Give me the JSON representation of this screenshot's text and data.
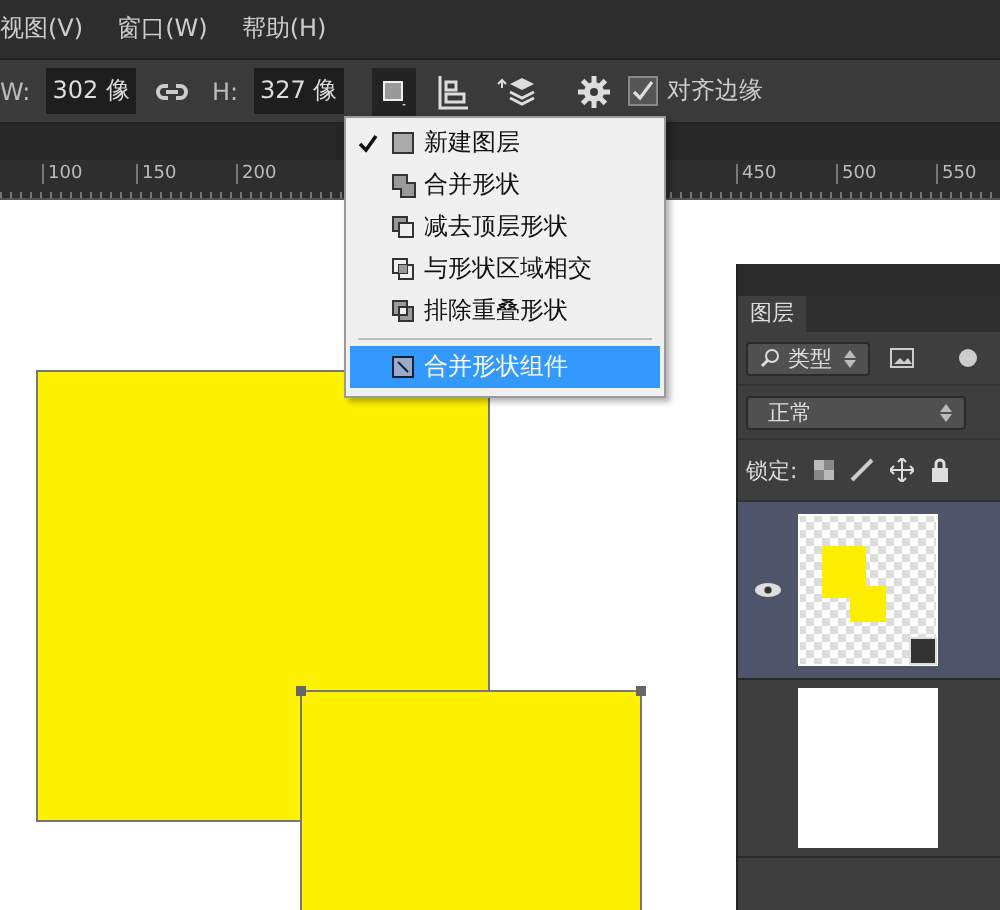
{
  "menubar": [
    "视图(V)",
    "窗口(W)",
    "帮助(H)"
  ],
  "options_bar": {
    "width_label": "W:",
    "width_value": "302 像",
    "height_label": "H:",
    "height_value": "327 像",
    "align_edges": {
      "label": "对齐边缘",
      "checked": true
    }
  },
  "path_operations_menu": {
    "items": [
      {
        "kind": "new-layer",
        "label": "新建图层",
        "checked": true,
        "selected": false
      },
      {
        "kind": "combine",
        "label": "合并形状",
        "checked": false,
        "selected": false
      },
      {
        "kind": "subtract",
        "label": "减去顶层形状",
        "checked": false,
        "selected": false
      },
      {
        "kind": "intersect",
        "label": "与形状区域相交",
        "checked": false,
        "selected": false
      },
      {
        "kind": "exclude",
        "label": "排除重叠形状",
        "checked": false,
        "selected": false
      },
      {
        "kind": "merge",
        "label": "合并形状组件",
        "checked": false,
        "selected": true
      }
    ]
  },
  "ruler": {
    "labels": [
      "100",
      "150",
      "200",
      "450",
      "500",
      "550"
    ]
  },
  "layers_panel": {
    "tab": "图层",
    "filter": "类型",
    "blend_mode": "正常",
    "lock_label": "锁定:",
    "layers": [
      {
        "kind": "shape",
        "visible": true,
        "selected": true
      },
      {
        "kind": "fill",
        "visible": false,
        "selected": false
      }
    ]
  }
}
